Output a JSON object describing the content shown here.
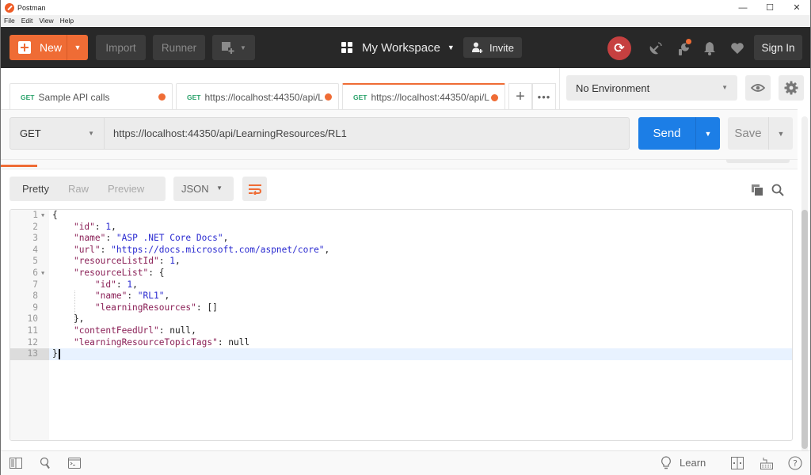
{
  "window": {
    "title": "Postman",
    "controls": {
      "minimize": "—",
      "maximize": "☐",
      "close": "✕"
    }
  },
  "menu": [
    "File",
    "Edit",
    "View",
    "Help"
  ],
  "header": {
    "new_label": "New",
    "import_label": "Import",
    "runner_label": "Runner",
    "workspace_label": "My Workspace",
    "invite_label": "Invite",
    "signin_label": "Sign In",
    "icons": [
      "new-window-icon",
      "sync-icon",
      "satellite-icon",
      "wrench-icon",
      "bell-icon",
      "heart-icon"
    ],
    "accent": "#ef6c35",
    "sync_color": "#c64040"
  },
  "tabs": [
    {
      "method": "GET",
      "label": "Sample API calls",
      "unsaved": true,
      "active": false
    },
    {
      "method": "GET",
      "label": "https://localhost:44350/api/L",
      "unsaved": true,
      "active": false
    },
    {
      "method": "GET",
      "label": "https://localhost:44350/api/L",
      "unsaved": true,
      "active": true
    }
  ],
  "environment": {
    "selected": "No Environment"
  },
  "request": {
    "method": "GET",
    "url": "https://localhost:44350/api/LearningResources/RL1",
    "send_label": "Send",
    "save_label": "Save",
    "send_color": "#1c7ee6"
  },
  "response": {
    "views": [
      "Pretty",
      "Raw",
      "Preview"
    ],
    "active_view": "Pretty",
    "format": "JSON",
    "lines": [
      {
        "n": "1",
        "fold": true
      },
      {
        "n": "2"
      },
      {
        "n": "3"
      },
      {
        "n": "4"
      },
      {
        "n": "5"
      },
      {
        "n": "6",
        "fold": true
      },
      {
        "n": "7"
      },
      {
        "n": "8"
      },
      {
        "n": "9"
      },
      {
        "n": "10"
      },
      {
        "n": "11"
      },
      {
        "n": "12"
      },
      {
        "n": "13",
        "current": true
      }
    ],
    "body": {
      "id": "1",
      "name": "\"ASP .NET Core Docs\"",
      "url": "\"https://docs.microsoft.com/aspnet/core\"",
      "resourceListId": "1",
      "resourceList_id": "1",
      "resourceList_name": "\"RL1\"",
      "resourceList_learningResources": "[]",
      "contentFeedUrl": "null",
      "learningResourceTopicTags": "null"
    },
    "keys": {
      "id": "\"id\"",
      "name": "\"name\"",
      "url": "\"url\"",
      "resourceListId": "\"resourceListId\"",
      "resourceList": "\"resourceList\"",
      "learningResources": "\"learningResources\"",
      "contentFeedUrl": "\"contentFeedUrl\"",
      "learningResourceTopicTags": "\"learningResourceTopicTags\""
    }
  },
  "statusbar": {
    "learn_label": "Learn"
  }
}
